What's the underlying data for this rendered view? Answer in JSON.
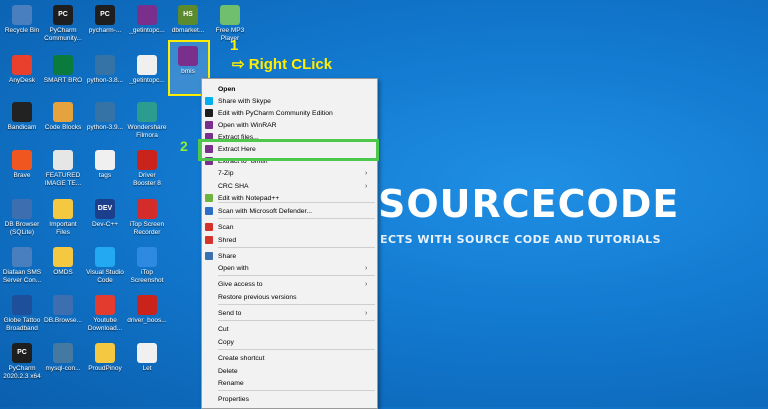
{
  "desktop": {
    "icons": [
      {
        "label": "Recycle Bin",
        "icon": "recycle-bin-icon",
        "color": "#4a7fbf"
      },
      {
        "label": "PyCharm\nCommunity...",
        "icon": "pycharm-icon",
        "color": "#1e1e1e",
        "glyph": "PC"
      },
      {
        "label": "pycharm-...",
        "icon": "pycharm-icon",
        "color": "#1e1e1e",
        "glyph": "PC"
      },
      {
        "label": "_getintopc...",
        "icon": "winrar-icon",
        "color": "#7b2f8c"
      },
      {
        "label": "dbmarket...",
        "icon": "hs-icon",
        "color": "#5b8a2f",
        "glyph": "HS"
      },
      {
        "label": "Free MP3\nPlayer",
        "icon": "mp3-player-icon",
        "color": "#6fbf6f"
      },
      {
        "label": "AnyDesk",
        "icon": "anydesk-icon",
        "color": "#e8402c"
      },
      {
        "label": "SMART BRO",
        "icon": "smart-bro-icon",
        "color": "#0a7b3d"
      },
      {
        "label": "python-3.8...",
        "icon": "python-icon",
        "color": "#3572a5"
      },
      {
        "label": "_getintopc...",
        "icon": "file-icon",
        "color": "#f0f0f0"
      },
      {
        "label": "Bandicam",
        "icon": "bandicam-icon",
        "color": "#222222"
      },
      {
        "label": "Code Blocks",
        "icon": "code-blocks-icon",
        "color": "#e6a23c"
      },
      {
        "label": "python-3.9...",
        "icon": "python-icon",
        "color": "#3572a5"
      },
      {
        "label": "Wondershare\nFilmora",
        "icon": "filmora-icon",
        "color": "#2c9c8f"
      },
      {
        "label": "Brave",
        "icon": "brave-icon",
        "color": "#f0561f"
      },
      {
        "label": "FEATURED\nIMAGE TE...",
        "icon": "image-file-icon",
        "color": "#e6e6e6"
      },
      {
        "label": "tags",
        "icon": "file-icon",
        "color": "#f0f0f0"
      },
      {
        "label": "Driver\nBooster 8",
        "icon": "driver-booster-icon",
        "color": "#c9231b"
      },
      {
        "label": "DB Browser\n(SQLite)",
        "icon": "db-browser-icon",
        "color": "#3d6fb0"
      },
      {
        "label": "Important\nFiles",
        "icon": "folder-icon",
        "color": "#f5c842"
      },
      {
        "label": "Dev-C++",
        "icon": "dev-cpp-icon",
        "color": "#1c3f8c",
        "glyph": "DEV"
      },
      {
        "label": "iTop Screen\nRecorder",
        "icon": "itop-recorder-icon",
        "color": "#d42b2b"
      },
      {
        "label": "Diafaan SMS\nServer Con...",
        "icon": "sms-server-icon",
        "color": "#4a7fbf"
      },
      {
        "label": "OMDS",
        "icon": "folder-icon",
        "color": "#f5c842"
      },
      {
        "label": "Visual Studio\nCode",
        "icon": "vscode-icon",
        "color": "#23a8f2"
      },
      {
        "label": "iTop\nScreenshot",
        "icon": "itop-screenshot-icon",
        "color": "#2d8ae0"
      },
      {
        "label": "Globe Tattoo\nBroadband",
        "icon": "globe-tattoo-icon",
        "color": "#1d4f9a"
      },
      {
        "label": "DB.Browse...",
        "icon": "db-browser-icon",
        "color": "#3d6fb0"
      },
      {
        "label": "Youtube\nDownload...",
        "icon": "youtube-download-icon",
        "color": "#e33b2e"
      },
      {
        "label": "driver_boos...",
        "icon": "driver-booster-icon",
        "color": "#c9231b"
      },
      {
        "label": "PyCharm\n2020.2.3 x64",
        "icon": "pycharm-icon",
        "color": "#1e1e1e",
        "glyph": "PC"
      },
      {
        "label": "mysql-con...",
        "icon": "mysql-icon",
        "color": "#4479a1"
      },
      {
        "label": "ProudPinoy",
        "icon": "folder-icon",
        "color": "#f5c842"
      },
      {
        "label": "Let",
        "icon": "file-icon",
        "color": "#f0f0f0"
      }
    ],
    "selected_icon": {
      "label": "bmis",
      "icon": "winrar-archive-icon",
      "color": "#7b2f8c"
    }
  },
  "brand": {
    "title": "SOURCECODE",
    "tagline": "ECTS WITH SOURCE CODE AND TUTORIALS"
  },
  "annotations": {
    "step1": "1",
    "step2": "2",
    "right_click": "Right CLick",
    "arrow": "⇨"
  },
  "context_menu": {
    "items": [
      {
        "label": "Open",
        "bold": true,
        "icon": "none",
        "color": "transparent"
      },
      {
        "label": "Share with Skype",
        "icon": "skype-icon",
        "color": "#00aff0"
      },
      {
        "label": "Edit with PyCharm Community Edition",
        "icon": "pycharm-icon",
        "color": "#1e1e1e"
      },
      {
        "label": "Open with WinRAR",
        "icon": "winrar-icon",
        "color": "#7b2f8c"
      },
      {
        "label": "Extract files...",
        "icon": "winrar-icon",
        "color": "#7b2f8c"
      },
      {
        "label": "Extract Here",
        "icon": "winrar-icon",
        "color": "#7b2f8c"
      },
      {
        "label": "Extract to \"bmis\\\"",
        "icon": "winrar-icon",
        "color": "#7b2f8c"
      },
      {
        "label": "7-Zip",
        "icon": "none",
        "color": "transparent",
        "submenu": true
      },
      {
        "label": "CRC SHA",
        "icon": "none",
        "color": "transparent",
        "submenu": true
      },
      {
        "label": "Edit with Notepad++",
        "icon": "notepad-plus-icon",
        "color": "#6db33f"
      },
      {
        "label": "Scan with Microsoft Defender...",
        "icon": "defender-icon",
        "color": "#2b6fc6"
      },
      {
        "label": "Scan",
        "icon": "scan-icon",
        "color": "#d4342c"
      },
      {
        "label": "Shred",
        "icon": "shred-icon",
        "color": "#d4342c"
      },
      {
        "label": "Share",
        "icon": "share-icon",
        "color": "#3a6fb0"
      },
      {
        "label": "Open with",
        "icon": "none",
        "color": "transparent",
        "submenu": true
      },
      {
        "label": "Give access to",
        "icon": "none",
        "color": "transparent",
        "submenu": true
      },
      {
        "label": "Restore previous versions",
        "icon": "none",
        "color": "transparent"
      },
      {
        "label": "Send to",
        "icon": "none",
        "color": "transparent",
        "submenu": true
      },
      {
        "label": "Cut",
        "icon": "none",
        "color": "transparent"
      },
      {
        "label": "Copy",
        "icon": "none",
        "color": "transparent"
      },
      {
        "label": "Create shortcut",
        "icon": "none",
        "color": "transparent"
      },
      {
        "label": "Delete",
        "icon": "none",
        "color": "transparent"
      },
      {
        "label": "Rename",
        "icon": "none",
        "color": "transparent"
      },
      {
        "label": "Properties",
        "icon": "none",
        "color": "transparent"
      }
    ],
    "submenu_glyph": "›"
  }
}
